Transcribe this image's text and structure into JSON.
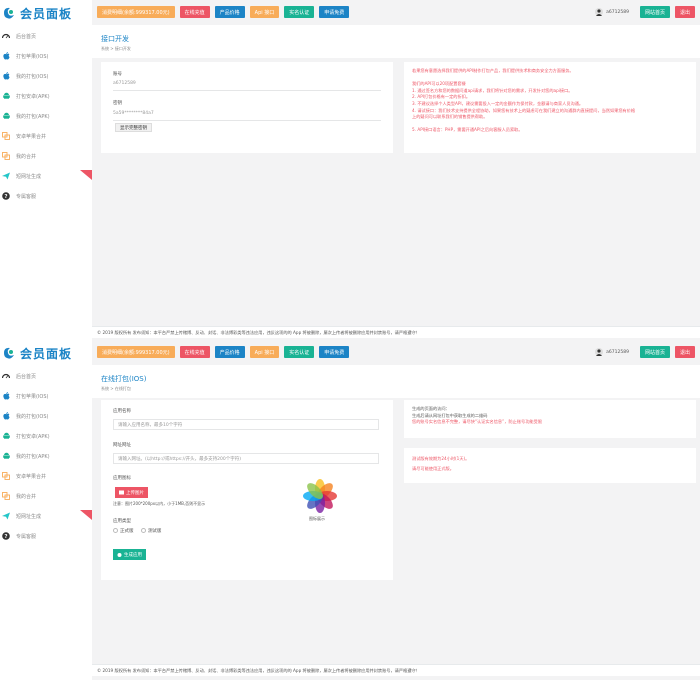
{
  "brand": {
    "title": "会员面板"
  },
  "sidebar": {
    "items": [
      {
        "label": "后台首页",
        "icon": "dashboard-icon"
      },
      {
        "label": "打包苹果(IOS)",
        "icon": "apple-icon"
      },
      {
        "label": "我的打包(IOS)",
        "icon": "apple-icon"
      },
      {
        "label": "打包安卓(APK)",
        "icon": "android-icon"
      },
      {
        "label": "我的打包(APK)",
        "icon": "android-icon"
      },
      {
        "label": "安卓苹果合并",
        "icon": "merge-icon"
      },
      {
        "label": "我的合并",
        "icon": "merge-icon"
      },
      {
        "label": "短网址生成",
        "icon": "send-icon"
      },
      {
        "label": "专属客服",
        "icon": "question-icon"
      }
    ]
  },
  "topbar": {
    "buttons": [
      "消费明细(余额:999317.00元)",
      "在线充值",
      "产品价格",
      "Api 接口",
      "实名认证",
      "申请免费"
    ],
    "username": "a6712589",
    "home_btn": "网站首页",
    "logout_btn": "退出"
  },
  "page1": {
    "title": "接口开发",
    "breadcrumb": "系统 > 接口开发",
    "account_label": "账号",
    "account_value": "a6712589",
    "secret_label": "密钥",
    "secret_value": "5a59********84a7",
    "show_secret_btn": "显示完整密钥",
    "notes": [
      "若果您有意愿选择我们提供的API制作打包产品，我们提供技术和商务安全力方面服务。",
      "",
      "我们的API可以20项配置套餐",
      "1. 通过签名方和您的数据问道api请求，我们将针对您的需求，开发针对您的api接口。",
      "2. API打包价格有一定的折扣。",
      "3. 不建议选择个人类型API，建议需要投入一定的金额作为保付款，金额请与商家人员沟通。",
      "4. 请试接口：我们技术支持提供全程协助，如果您有技术上的疑虑可在我们建立的沟通群内直接提问，当然如果您有价格",
      "上的疑问可以联系我们的销售提供帮助。",
      "",
      "5. API接口语言：PHP，需要开通API之后向客服人员索取。"
    ]
  },
  "footer": "© 2019 版权所有 发布须知：本平台严禁上传赌博、反动、封话、非法博彩类等违法应用，违反这项的的 App 将被删除，屡次上传者将被删除应用并封禁账号，请严格遵守！",
  "page2": {
    "title": "在线打包(IOS)",
    "breadcrumb": "系统 > 在线打包",
    "app_name_label": "应用名称",
    "app_name_placeholder": "请输入应用名称，最多10个字符",
    "url_label": "网址网址",
    "url_placeholder": "请输入网址。(以http://或https://开头，最多支持200个字符)",
    "icon_label": "应用图标",
    "upload_btn": "上传图片",
    "icon_note": "注意：图片200*200px以内，小于1MB,否则不显示",
    "icon_caption": "图标展示",
    "type_label": "应用类型",
    "type_options": [
      "正式版",
      "测试版"
    ],
    "submit_btn": "生成应用",
    "note1": [
      "生成的页面的访问：",
      "生成后请从网址打包中获取生成的二维码",
      "您的账号实名信息不完整，请尽快“认证实名信息”，防止账号功能受限"
    ],
    "note2": [
      "测试版有效期为24小时(1天)。",
      "请尽可能使用正式版。"
    ]
  }
}
